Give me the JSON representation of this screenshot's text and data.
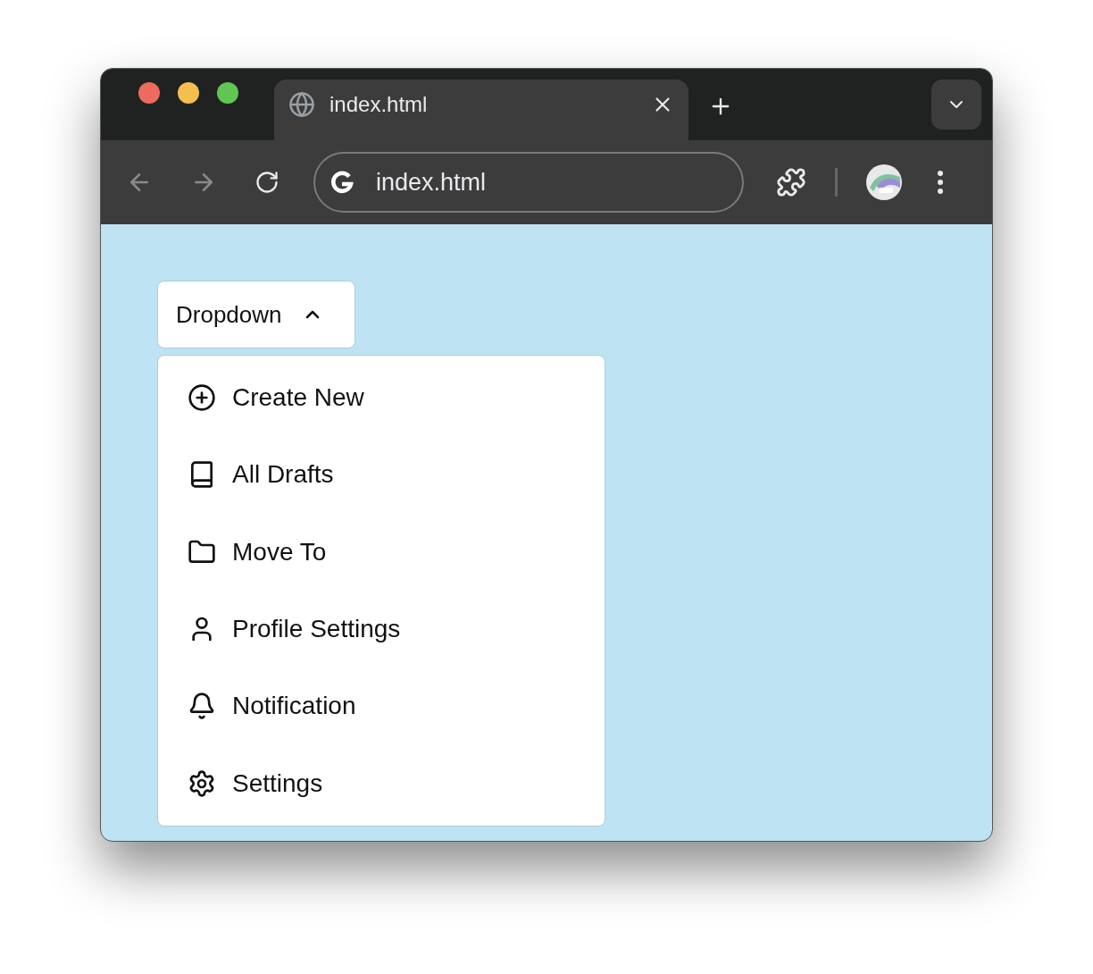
{
  "tab": {
    "title": "index.html"
  },
  "address_bar": {
    "url": "index.html"
  },
  "dropdown": {
    "label": "Dropdown",
    "expanded": true
  },
  "menu": {
    "items": [
      {
        "label": "Create New"
      },
      {
        "label": "All Drafts"
      },
      {
        "label": "Move To"
      },
      {
        "label": "Profile Settings"
      },
      {
        "label": "Notification"
      },
      {
        "label": "Settings"
      }
    ]
  }
}
